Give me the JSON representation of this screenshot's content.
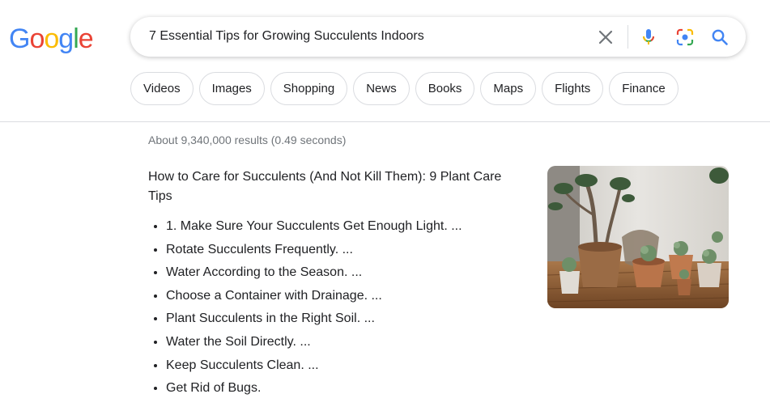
{
  "logo": {
    "letters": [
      "G",
      "o",
      "o",
      "g",
      "l",
      "e"
    ],
    "colors": [
      "#4285F4",
      "#EA4335",
      "#FBBC05",
      "#4285F4",
      "#34A853",
      "#EA4335"
    ]
  },
  "search": {
    "query": "7 Essential Tips for Growing Succulents Indoors"
  },
  "icons": {
    "clear": "close-icon",
    "mic": "microphone-icon",
    "lens": "camera-lens-icon",
    "search": "search-icon"
  },
  "chips": [
    "Videos",
    "Images",
    "Shopping",
    "News",
    "Books",
    "Maps",
    "Flights",
    "Finance"
  ],
  "stats": "About 9,340,000 results (0.49 seconds)",
  "result": {
    "title": "How to Care for Succulents (And Not Kill Them): 9 Plant Care Tips",
    "items": [
      "1. Make Sure Your Succulents Get Enough Light. ...",
      "Rotate Succulents Frequently. ...",
      "Water According to the Season. ...",
      "Choose a Container with Drainage. ...",
      "Plant Succulents in the Right Soil. ...",
      "Water the Soil Directly. ...",
      "Keep Succulents Clean. ...",
      "Get Rid of Bugs."
    ]
  }
}
